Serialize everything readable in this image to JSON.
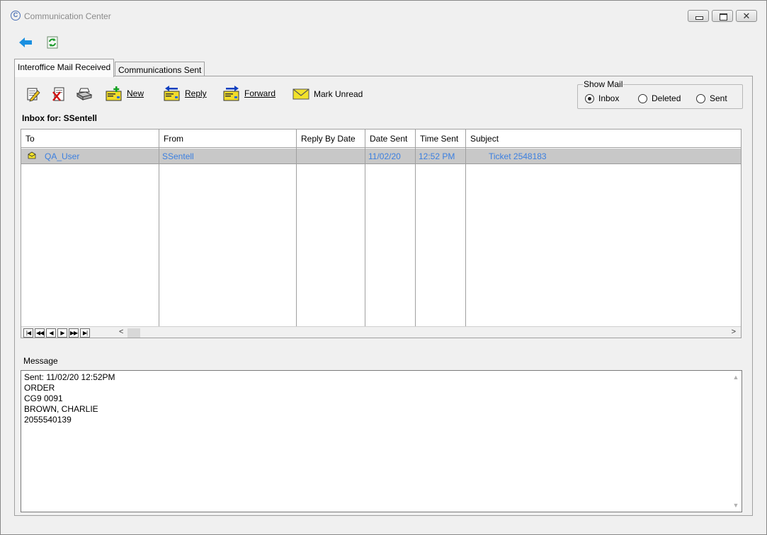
{
  "window": {
    "title": "Communication Center",
    "app_icon_glyph": "C"
  },
  "tabs": [
    {
      "label": "Interoffice Mail Received",
      "active": true
    },
    {
      "label": "Communications Sent",
      "active": false
    }
  ],
  "toolbar": {
    "new_label": "New",
    "reply_label": "Reply",
    "forward_label": "Forward",
    "mark_unread_label": "Mark Unread",
    "icons": [
      "edit-note-icon",
      "delete-note-icon",
      "print-icon",
      "new-mail-icon",
      "reply-mail-icon",
      "forward-mail-icon",
      "envelope-icon"
    ]
  },
  "show_mail": {
    "legend": "Show Mail",
    "options": [
      "Inbox",
      "Deleted",
      "Sent"
    ],
    "selected": "Inbox"
  },
  "inbox_label": "Inbox for: SSentell",
  "grid": {
    "columns": [
      "To",
      "From",
      "Reply By Date",
      "Date Sent",
      "Time Sent",
      "Subject"
    ],
    "rows": [
      {
        "to": "QA_User",
        "from": "SSentell",
        "reply_by_date": "",
        "date_sent": "11/02/20",
        "time_sent": "12:52 PM",
        "subject": "Ticket 2548183",
        "selected": true
      }
    ],
    "nav_buttons": [
      "|◀",
      "◀◀",
      "◀",
      "▶",
      "▶▶",
      "▶|"
    ]
  },
  "message": {
    "label": "Message",
    "lines": [
      "Sent:  11/02/20 12:52PM",
      "ORDER",
      "CG9 0091",
      "BROWN, CHARLIE",
      "2055540139"
    ]
  },
  "colors": {
    "link_blue": "#3b7fe0",
    "selected_row": "#c8c8c8",
    "window_bg": "#f0f0f0"
  }
}
